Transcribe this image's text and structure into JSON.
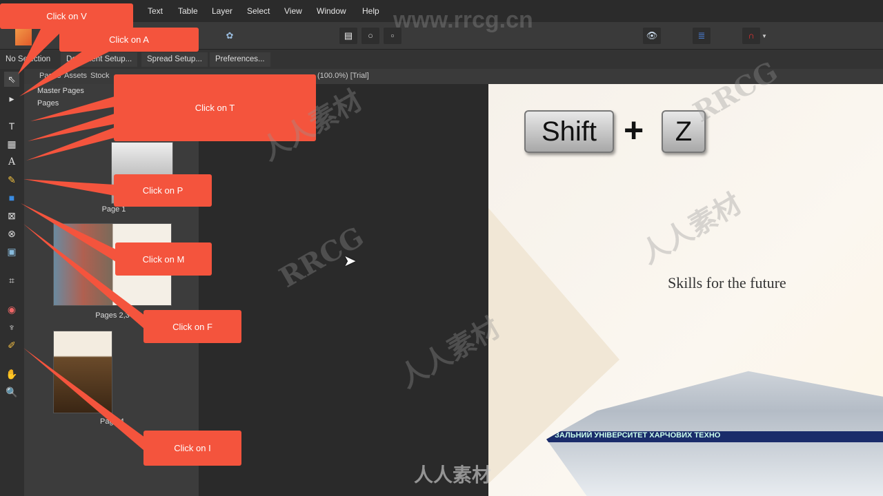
{
  "menu": [
    "Text",
    "Table",
    "Layer",
    "Select",
    "View",
    "Window",
    "Help"
  ],
  "context": {
    "selection": "No Selection",
    "buttons": [
      "Document Setup...",
      "Spread Setup...",
      "Preferences..."
    ]
  },
  "tabs": [
    "Pages",
    "Assets",
    "Stock"
  ],
  "doc_title": "(100.0%) [Trial]",
  "panel": {
    "master": "Master Pages",
    "pages": "Pages",
    "thumbs": [
      "Page 1",
      "Pages 2,3",
      "Page 4"
    ]
  },
  "slide": {
    "key1": "Shift",
    "plus": "+",
    "key2": "Z",
    "text": "Skills for the future",
    "banner": "ЗАЛЬНИЙ УНІВЕРСИТЕТ ХАРЧОВИХ ТЕХНО"
  },
  "callouts": [
    "Click on V",
    "Click on A",
    "Click on T",
    "Click on P",
    "Click on M",
    "Click on F",
    "Click on I"
  ],
  "watermarks": {
    "url": "www.rrcg.cn",
    "brand": "RRCG",
    "cn": "人人素材"
  },
  "colors": {
    "callout": "#f4543d",
    "accent": "#f08a3a"
  }
}
